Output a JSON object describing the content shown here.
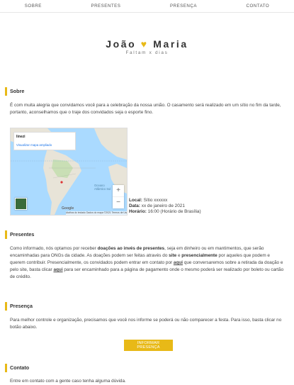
{
  "nav": {
    "items": [
      {
        "label": "SOBRE"
      },
      {
        "label": "PRESENTES"
      },
      {
        "label": "PRESENÇA"
      },
      {
        "label": "CONTATO"
      }
    ]
  },
  "hero": {
    "name_left": "João",
    "heart": "♥",
    "name_right": "Maria",
    "countdown": "Faltam x dias"
  },
  "sobre": {
    "title": "Sobre",
    "text": "É com muita alegria que convidamos você para a celebração da nossa união. O casamento será realizado em um sítio no fim da tarde, portanto, aconselhamos que o traje dos convidados seja o esporte fino."
  },
  "map": {
    "place_label": "linezi",
    "link_label": "Visualizar mapa ampliado",
    "ocean_label": "Oceano Atlântico Sul",
    "zoom_in": "+",
    "zoom_out": "−",
    "google": "Google",
    "footer": "Atalhos do teclado  Dados do mapa ©2021  Termos de Uso"
  },
  "details": {
    "local_label": "Local:",
    "local_value": "Sítio xxxxxx",
    "date_label": "Data:",
    "date_value": "xx de janeiro de 2021",
    "time_label": "Horário:",
    "time_value": "16:00 (Horário de Brasília)"
  },
  "presentes": {
    "title": "Presentes",
    "p1": "Como informado, nós optamos por receber ",
    "p1_bold": "doações ao invés de presentes",
    "p2": ", seja em dinheiro ou em mantimentos, que serão encaminhadas para ONGs da cidade. As doações podem ser feitas através do ",
    "p2_bold": "site",
    "p3": " e ",
    "p3_bold": "presencialmente",
    "p4": " por aqueles que podem e querem contribuir. Presencialmente, os convidados podem entrar em contato por ",
    "link1": "aqui",
    "p5": " que conversaremos sobre a retirada da doação e pelo site, basta clicar ",
    "link2": "aqui",
    "p6": " para ser encaminhado para a página de pagamento onde o mesmo poderá ser realizado por boleto ou cartão de crédito."
  },
  "presenca": {
    "title": "Presença",
    "text": "Para melhor controle e organização, precisamos que você nos informe se poderá ou não comparecer a festa. Para isso, basta clicar no botão abaixo.",
    "button": "INFORMAR PRESENÇA"
  },
  "contato": {
    "title": "Contato",
    "text": "Entre em contato com a gente caso tenha alguma dúvida."
  },
  "colors": {
    "accent": "#e8b917",
    "map_water": "#aadaff",
    "map_land": "#e8e4d8"
  }
}
